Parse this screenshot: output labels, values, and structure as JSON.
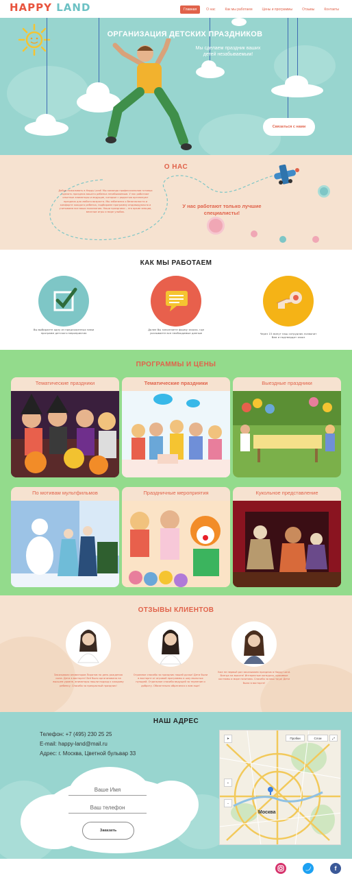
{
  "logo": {
    "part1": "HAPPY",
    "part2": "LAND"
  },
  "nav": {
    "items": [
      "Главная",
      "О нас",
      "Как мы работаем",
      "Цены и программы",
      "Отзывы",
      "Контакты"
    ],
    "active": "Главная"
  },
  "hero": {
    "title": "ОРГАНИЗАЦИЯ ДЕТСКИХ ПРАЗДНИКОВ",
    "subtitle": "Мы сделаем праздник ваших детей незабываемым!",
    "cta": "Связаться с нами"
  },
  "about": {
    "title": "О НАС",
    "text": "Добро пожаловать в Happy Land! Мы команда профессионалов готовых сделать праздник вашего ребенка незабываемым. У нас работают опытные аниматоры и ведущие, которые с радостью организуют праздник для любого возраста. Мы заботимся о безопасности и комфорте каждого ребенка, подбираем программу индивидуально и учитываем все ваши пожелания. Наши праздники – это яркие эмоции, веселые игры и море улыбок.",
    "subtitle": "У нас работают только лучшие специалисты!"
  },
  "how": {
    "title": "КАК МЫ РАБОТАЕМ",
    "steps": [
      {
        "text": "Вы выбираете одну из предложенных нами программ детского мероприятия"
      },
      {
        "text": "Далее Вы заполняете форму заказа, где указываете все необходимые данные"
      },
      {
        "text": "Через 15 минут наш сотрудник позвонит Вам и подтвердит заказ"
      }
    ]
  },
  "programs": {
    "title": "ПРОГРАММЫ И ЦЕНЫ",
    "cards": [
      {
        "title": "Тематические праздники"
      },
      {
        "title": "Тематические праздники"
      },
      {
        "title": "Выездные праздники"
      },
      {
        "title": "По мотивам мультфильмов"
      },
      {
        "title": "Праздничные мероприятия"
      },
      {
        "title": "Кукольное представление"
      }
    ]
  },
  "reviews": {
    "title": "ОТЗЫВЫ КЛИЕНТОВ",
    "items": [
      {
        "text": "Заказывали аниматоров Пиратов на день рождения сына. Дети в восторге! Всё было организовано на высшем уровне, аниматоры нашли подход к каждому ребенку. Спасибо за прекрасный праздник!"
      },
      {
        "text": "Огромное спасибо за праздник нашей дочки! Дети были в восторге от игровой программы и шоу мыльных пузырей. Отдельное спасибо ведущей за терпение и доброту. Обязательно обратимся к вам еще!"
      },
      {
        "text": "Уже не первый раз заказываем праздник в Happy Land. Всегда на высоте! Интересные конкурсы, красивые костюмы и море позитива. Спасибо за ваш труд! Дети были в восторге!"
      }
    ]
  },
  "address": {
    "title": "НАШ АДРЕС",
    "phone": "Телефон: +7 (495) 230 25 25",
    "email": "E-mail: happy-land@mail.ru",
    "addr": "Адрес: г. Москва, Цветной бульвар 33",
    "name_placeholder": "Ваше Имя",
    "phone_placeholder": "Ваш телефон",
    "order": "Заказать",
    "map": {
      "city": "Москва",
      "traffic": "Пробки",
      "layers": "Слои",
      "zoom_in": "+",
      "zoom_out": "−"
    }
  },
  "footer": {
    "social": [
      {
        "name": "instagram",
        "color": "#d6336c"
      },
      {
        "name": "twitter",
        "color": "#1da1f2"
      },
      {
        "name": "facebook",
        "color": "#3b5998"
      }
    ]
  },
  "colors": {
    "accent": "#e0624a",
    "hero_bg": "#98d5cf",
    "about_bg": "#f6e2d0",
    "programs_bg": "#93db8c"
  }
}
